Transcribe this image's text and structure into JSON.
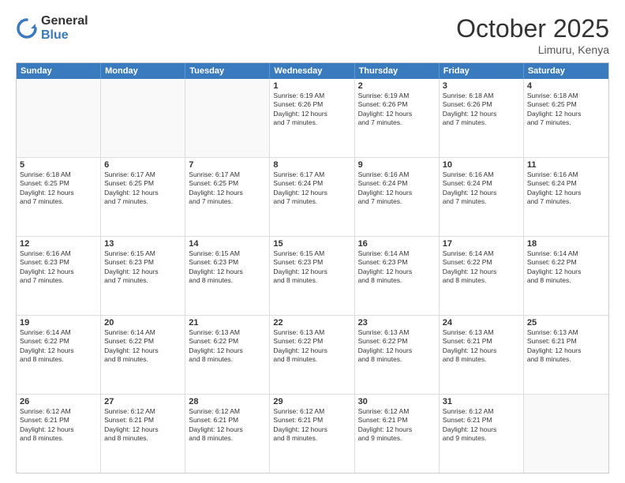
{
  "logo": {
    "general": "General",
    "blue": "Blue"
  },
  "header": {
    "title": "October 2025",
    "subtitle": "Limuru, Kenya"
  },
  "weekdays": [
    "Sunday",
    "Monday",
    "Tuesday",
    "Wednesday",
    "Thursday",
    "Friday",
    "Saturday"
  ],
  "rows": [
    [
      {
        "day": "",
        "lines": []
      },
      {
        "day": "",
        "lines": []
      },
      {
        "day": "",
        "lines": []
      },
      {
        "day": "1",
        "lines": [
          "Sunrise: 6:19 AM",
          "Sunset: 6:26 PM",
          "Daylight: 12 hours",
          "and 7 minutes."
        ]
      },
      {
        "day": "2",
        "lines": [
          "Sunrise: 6:19 AM",
          "Sunset: 6:26 PM",
          "Daylight: 12 hours",
          "and 7 minutes."
        ]
      },
      {
        "day": "3",
        "lines": [
          "Sunrise: 6:18 AM",
          "Sunset: 6:26 PM",
          "Daylight: 12 hours",
          "and 7 minutes."
        ]
      },
      {
        "day": "4",
        "lines": [
          "Sunrise: 6:18 AM",
          "Sunset: 6:25 PM",
          "Daylight: 12 hours",
          "and 7 minutes."
        ]
      }
    ],
    [
      {
        "day": "5",
        "lines": [
          "Sunrise: 6:18 AM",
          "Sunset: 6:25 PM",
          "Daylight: 12 hours",
          "and 7 minutes."
        ]
      },
      {
        "day": "6",
        "lines": [
          "Sunrise: 6:17 AM",
          "Sunset: 6:25 PM",
          "Daylight: 12 hours",
          "and 7 minutes."
        ]
      },
      {
        "day": "7",
        "lines": [
          "Sunrise: 6:17 AM",
          "Sunset: 6:25 PM",
          "Daylight: 12 hours",
          "and 7 minutes."
        ]
      },
      {
        "day": "8",
        "lines": [
          "Sunrise: 6:17 AM",
          "Sunset: 6:24 PM",
          "Daylight: 12 hours",
          "and 7 minutes."
        ]
      },
      {
        "day": "9",
        "lines": [
          "Sunrise: 6:16 AM",
          "Sunset: 6:24 PM",
          "Daylight: 12 hours",
          "and 7 minutes."
        ]
      },
      {
        "day": "10",
        "lines": [
          "Sunrise: 6:16 AM",
          "Sunset: 6:24 PM",
          "Daylight: 12 hours",
          "and 7 minutes."
        ]
      },
      {
        "day": "11",
        "lines": [
          "Sunrise: 6:16 AM",
          "Sunset: 6:24 PM",
          "Daylight: 12 hours",
          "and 7 minutes."
        ]
      }
    ],
    [
      {
        "day": "12",
        "lines": [
          "Sunrise: 6:16 AM",
          "Sunset: 6:23 PM",
          "Daylight: 12 hours",
          "and 7 minutes."
        ]
      },
      {
        "day": "13",
        "lines": [
          "Sunrise: 6:15 AM",
          "Sunset: 6:23 PM",
          "Daylight: 12 hours",
          "and 7 minutes."
        ]
      },
      {
        "day": "14",
        "lines": [
          "Sunrise: 6:15 AM",
          "Sunset: 6:23 PM",
          "Daylight: 12 hours",
          "and 8 minutes."
        ]
      },
      {
        "day": "15",
        "lines": [
          "Sunrise: 6:15 AM",
          "Sunset: 6:23 PM",
          "Daylight: 12 hours",
          "and 8 minutes."
        ]
      },
      {
        "day": "16",
        "lines": [
          "Sunrise: 6:14 AM",
          "Sunset: 6:23 PM",
          "Daylight: 12 hours",
          "and 8 minutes."
        ]
      },
      {
        "day": "17",
        "lines": [
          "Sunrise: 6:14 AM",
          "Sunset: 6:22 PM",
          "Daylight: 12 hours",
          "and 8 minutes."
        ]
      },
      {
        "day": "18",
        "lines": [
          "Sunrise: 6:14 AM",
          "Sunset: 6:22 PM",
          "Daylight: 12 hours",
          "and 8 minutes."
        ]
      }
    ],
    [
      {
        "day": "19",
        "lines": [
          "Sunrise: 6:14 AM",
          "Sunset: 6:22 PM",
          "Daylight: 12 hours",
          "and 8 minutes."
        ]
      },
      {
        "day": "20",
        "lines": [
          "Sunrise: 6:14 AM",
          "Sunset: 6:22 PM",
          "Daylight: 12 hours",
          "and 8 minutes."
        ]
      },
      {
        "day": "21",
        "lines": [
          "Sunrise: 6:13 AM",
          "Sunset: 6:22 PM",
          "Daylight: 12 hours",
          "and 8 minutes."
        ]
      },
      {
        "day": "22",
        "lines": [
          "Sunrise: 6:13 AM",
          "Sunset: 6:22 PM",
          "Daylight: 12 hours",
          "and 8 minutes."
        ]
      },
      {
        "day": "23",
        "lines": [
          "Sunrise: 6:13 AM",
          "Sunset: 6:22 PM",
          "Daylight: 12 hours",
          "and 8 minutes."
        ]
      },
      {
        "day": "24",
        "lines": [
          "Sunrise: 6:13 AM",
          "Sunset: 6:21 PM",
          "Daylight: 12 hours",
          "and 8 minutes."
        ]
      },
      {
        "day": "25",
        "lines": [
          "Sunrise: 6:13 AM",
          "Sunset: 6:21 PM",
          "Daylight: 12 hours",
          "and 8 minutes."
        ]
      }
    ],
    [
      {
        "day": "26",
        "lines": [
          "Sunrise: 6:12 AM",
          "Sunset: 6:21 PM",
          "Daylight: 12 hours",
          "and 8 minutes."
        ]
      },
      {
        "day": "27",
        "lines": [
          "Sunrise: 6:12 AM",
          "Sunset: 6:21 PM",
          "Daylight: 12 hours",
          "and 8 minutes."
        ]
      },
      {
        "day": "28",
        "lines": [
          "Sunrise: 6:12 AM",
          "Sunset: 6:21 PM",
          "Daylight: 12 hours",
          "and 8 minutes."
        ]
      },
      {
        "day": "29",
        "lines": [
          "Sunrise: 6:12 AM",
          "Sunset: 6:21 PM",
          "Daylight: 12 hours",
          "and 8 minutes."
        ]
      },
      {
        "day": "30",
        "lines": [
          "Sunrise: 6:12 AM",
          "Sunset: 6:21 PM",
          "Daylight: 12 hours",
          "and 9 minutes."
        ]
      },
      {
        "day": "31",
        "lines": [
          "Sunrise: 6:12 AM",
          "Sunset: 6:21 PM",
          "Daylight: 12 hours",
          "and 9 minutes."
        ]
      },
      {
        "day": "",
        "lines": []
      }
    ]
  ]
}
